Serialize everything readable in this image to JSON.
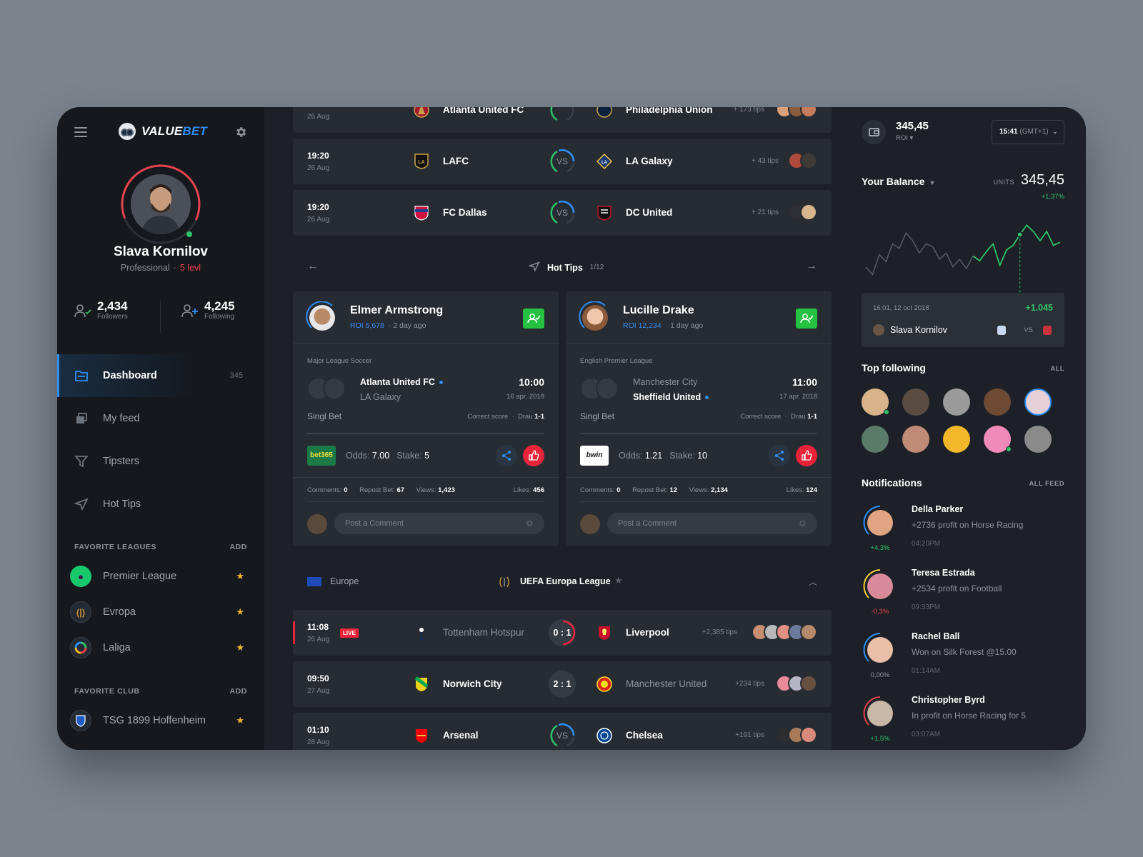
{
  "colors": {
    "accent": "#2f8ef4",
    "live": "#e8233a",
    "positive": "#2ec26b",
    "negative": "#e8424f",
    "star": "#f3b72c",
    "follow": "#26c043"
  },
  "sidebar": {
    "logo": {
      "part1": "VALUE",
      "part2": "BET"
    },
    "user": {
      "name": "Slava Kornilov",
      "role": "Professional",
      "level": "5 levl"
    },
    "stats": [
      {
        "value": "2,434",
        "label": "Followers"
      },
      {
        "value": "4,245",
        "label": "Following"
      }
    ],
    "nav": [
      {
        "label": "Dashboard",
        "count": "345",
        "icon": "folder-icon"
      },
      {
        "label": "My feed",
        "icon": "feed-icon"
      },
      {
        "label": "Tipsters",
        "icon": "filter-icon"
      },
      {
        "label": "Hot Tips",
        "icon": "send-icon"
      }
    ],
    "favorite_leagues": {
      "title": "FAVORITE LEAGUES",
      "add": "ADD",
      "items": [
        {
          "label": "Premier League"
        },
        {
          "label": "Evropa"
        },
        {
          "label": "Laliga"
        }
      ]
    },
    "favorite_club": {
      "title": "FAVORITE CLUB",
      "add": "ADD",
      "items": [
        {
          "label": "TSG 1899 Hoffenheim"
        }
      ]
    }
  },
  "matches_top": [
    {
      "date": "26 Aug",
      "home": "Atlanta United FC",
      "away": "Philadelphia Union",
      "tips": "+ 173 tips"
    },
    {
      "time": "19:20",
      "date": "26 Aug",
      "home": "LAFC",
      "vs": "VS",
      "away": "LA Galaxy",
      "tips": "+ 43 tips"
    },
    {
      "time": "19:20",
      "date": "26 Aug",
      "home": "FC Dallas",
      "vs": "VS",
      "away": "DC United",
      "tips": "+ 21 tips"
    }
  ],
  "hot_tips": {
    "title": "Hot Tips",
    "page": "1/12",
    "cards": [
      {
        "name": "Elmer Armstrong",
        "roi": "ROI 5,678",
        "ago": "2 day ago",
        "league": "Major League Soccer",
        "team_a": "Atlanta United FC",
        "team_b": "LA Galaxy",
        "time": "10:00",
        "date": "16 apr. 2018",
        "bet_type": "Singl Bet",
        "market": "Correct score",
        "pick_label": "Drau",
        "pick": "1-1",
        "bookie": "bet365",
        "odds_label": "Odds:",
        "odds": "7.00",
        "stake_label": "Stake:",
        "stake": "5",
        "comments_label": "Comments:",
        "comments": "0",
        "repost_label": "Repost Bet:",
        "repost": "67",
        "views_label": "Views:",
        "views": "1,423",
        "likes_label": "Likes:",
        "likes": "456",
        "comment_placeholder": "Post a Comment"
      },
      {
        "name": "Lucille Drake",
        "roi": "ROI 12,234",
        "ago": "1 day ago",
        "league": "English Premier League",
        "team_a": "Manchester City",
        "team_b": "Sheffield United",
        "time": "11:00",
        "date": "17 apr. 2018",
        "bet_type": "Singl Bet",
        "market": "Correct score",
        "pick_label": "Drau",
        "pick": "1-1",
        "bookie": "bwin",
        "odds_label": "Odds:",
        "odds": "1.21",
        "stake_label": "Stake:",
        "stake": "10",
        "comments_label": "Comments:",
        "comments": "0",
        "repost_label": "Repost Bet:",
        "repost": "12",
        "views_label": "Views:",
        "views": "2,134",
        "likes_label": "Likes:",
        "likes": "124",
        "comment_placeholder": "Post a Comment"
      }
    ]
  },
  "league_section": {
    "region": "Europe",
    "league": "UEFA Europa League"
  },
  "matches_bottom": [
    {
      "time": "11:08",
      "date": "26 Aug",
      "live": "LIVE",
      "home": "Tottenham Hotspur",
      "score": "0 : 1",
      "away": "Liverpool",
      "tips": "+2,385 tips"
    },
    {
      "time": "09:50",
      "date": "27 Aug",
      "home": "Norwich City",
      "score": "2 : 1",
      "away": "Manchester United",
      "tips": "+234 tips"
    },
    {
      "time": "01:10",
      "date": "28 Aug",
      "home": "Arsenal",
      "vs": "VS",
      "away": "Chelsea",
      "tips": "+191 tips"
    }
  ],
  "right": {
    "balance": "345,45",
    "roi_label": "ROI",
    "time": "15:41",
    "timezone": "(GMT+1)",
    "your_balance": "Your Balance",
    "units_label": "UNITS",
    "units_value": "345,45",
    "units_change": "+1,37%",
    "chart_data": {
      "type": "line",
      "values": [
        28,
        18,
        44,
        35,
        58,
        52,
        72,
        62,
        46,
        58,
        54,
        38,
        46,
        28,
        38,
        26,
        42,
        36,
        48,
        58,
        30,
        50,
        56,
        70,
        82,
        74,
        62,
        74,
        56,
        60
      ],
      "highlight_index": 23,
      "ylim": [
        0,
        100
      ]
    },
    "balance_card": {
      "timestamp": "16:01, 12 oct 2018",
      "profit": "+1.045",
      "user": "Slava Kornilov",
      "vs": "VS"
    },
    "top_following": {
      "title": "Top following",
      "link": "ALL"
    },
    "notifications": {
      "title": "Notifications",
      "link": "ALL FEED",
      "items": [
        {
          "name": "Della Parker",
          "text": "+2736 profit on Horse Racing",
          "time": "04:20PM",
          "pct": "+4,3%"
        },
        {
          "name": "Teresa Estrada",
          "text": "+2534 profit on Football",
          "time": "09:33PM",
          "pct": "-0,3%"
        },
        {
          "name": "Rachel Ball",
          "text": "Won on Silk Forest @15.00",
          "time": "01:14AM",
          "pct": "0,00%"
        },
        {
          "name": "Christopher Byrd",
          "text": "In profit on Horse Racing for 5",
          "time": "03:07AM",
          "pct": "+1,5%"
        }
      ]
    }
  }
}
